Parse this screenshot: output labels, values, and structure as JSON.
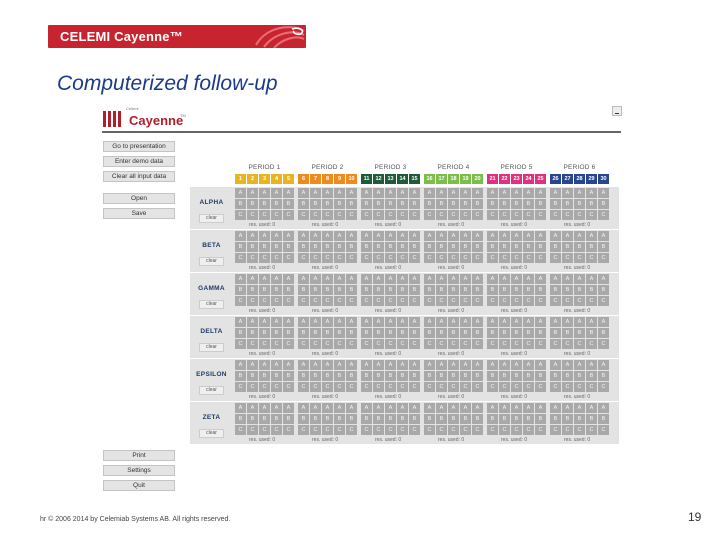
{
  "header": {
    "brand": "CELEMI Cayenne™",
    "slide_title": "Computerized follow-up"
  },
  "app": {
    "logo_small": "Celemi",
    "logo_name": "Cayenne",
    "logo_tm": "TM",
    "side_buttons": [
      {
        "id": "go-to-presentation",
        "label": "Go to presentation"
      },
      {
        "id": "enter-demo-data",
        "label": "Enter demo data"
      },
      {
        "id": "clear-all-input-data",
        "label": "Clear all input data"
      },
      {
        "id": "open",
        "label": "Open"
      },
      {
        "id": "save",
        "label": "Save"
      },
      {
        "id": "print",
        "label": "Print"
      },
      {
        "id": "settings",
        "label": "Settings"
      },
      {
        "id": "quit",
        "label": "Quit"
      }
    ],
    "periods": [
      {
        "label": "PERIOD 1",
        "numbers": [
          "1",
          "2",
          "3",
          "4",
          "5"
        ],
        "color": "#e7b522"
      },
      {
        "label": "PERIOD 2",
        "numbers": [
          "6",
          "7",
          "8",
          "9",
          "10"
        ],
        "color": "#ef8a1d"
      },
      {
        "label": "PERIOD 3",
        "numbers": [
          "11",
          "12",
          "13",
          "14",
          "15"
        ],
        "color": "#1f5a3b"
      },
      {
        "label": "PERIOD 4",
        "numbers": [
          "16",
          "17",
          "18",
          "19",
          "20"
        ],
        "color": "#7bbf4a"
      },
      {
        "label": "PERIOD 5",
        "numbers": [
          "21",
          "22",
          "23",
          "24",
          "25"
        ],
        "color": "#e0307f"
      },
      {
        "label": "PERIOD 6",
        "numbers": [
          "26",
          "27",
          "28",
          "29",
          "30"
        ],
        "color": "#27468d"
      }
    ],
    "row_letters": [
      "A",
      "B",
      "C"
    ],
    "res_used_label": "res. used: 0",
    "clear_label": "clear",
    "groups": [
      "ALPHA",
      "BETA",
      "GAMMA",
      "DELTA",
      "EPSILON",
      "ZETA"
    ]
  },
  "footer": {
    "copyright": "hr © 2006 2014 by Celemiab Systems AB. All rights reserved.",
    "page_number": "19"
  }
}
